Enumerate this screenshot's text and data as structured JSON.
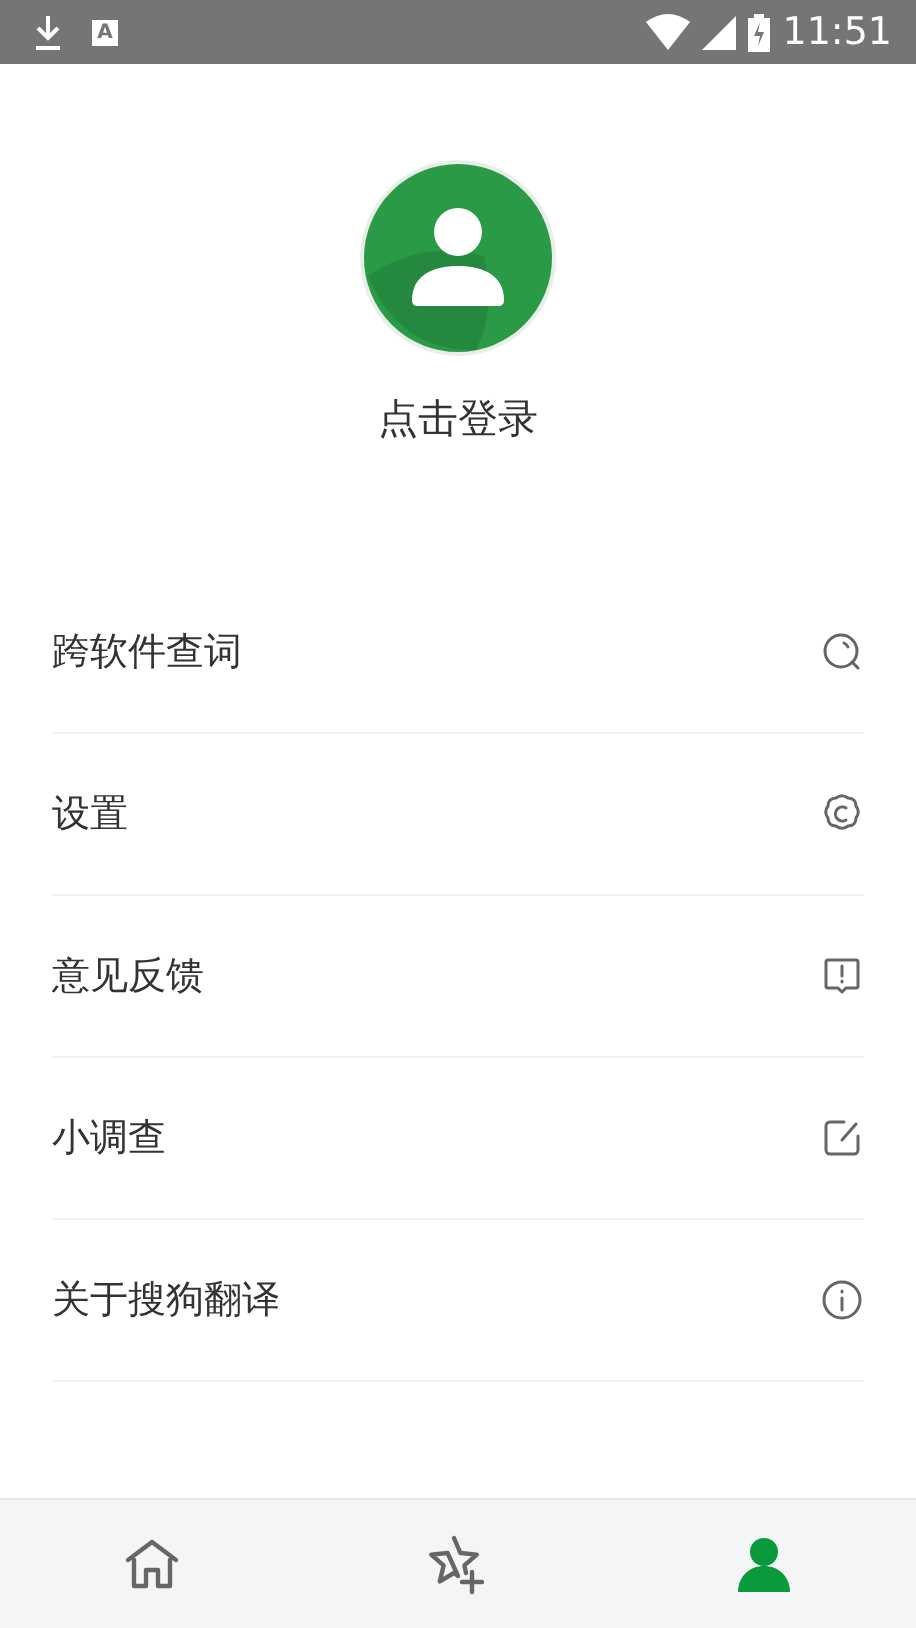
{
  "status_bar": {
    "time": "11:51",
    "letter_icon": "A"
  },
  "profile": {
    "login_label": "点击登录"
  },
  "menu": [
    {
      "label": "跨软件查词",
      "kind": "search"
    },
    {
      "label": "设置",
      "kind": "settings"
    },
    {
      "label": "意见反馈",
      "kind": "feedback"
    },
    {
      "label": "小调查",
      "kind": "survey"
    },
    {
      "label": "关于搜狗翻译",
      "kind": "info"
    }
  ],
  "tabs": [
    {
      "kind": "home",
      "selected": false
    },
    {
      "kind": "favorites",
      "selected": false
    },
    {
      "kind": "profile",
      "selected": true
    }
  ]
}
